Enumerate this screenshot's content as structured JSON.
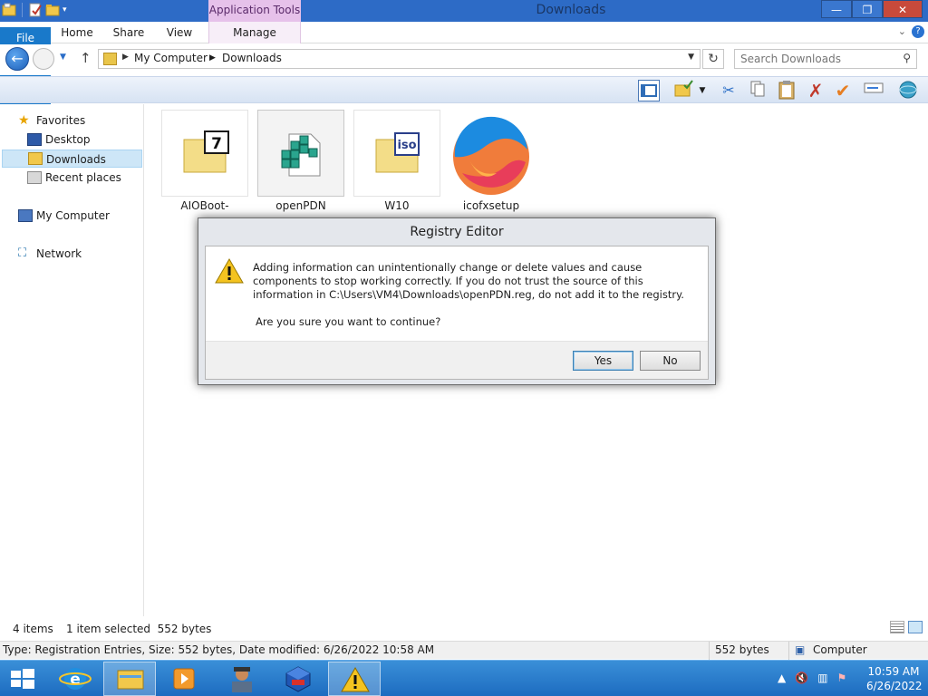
{
  "window": {
    "title": "Downloads",
    "context_tab": "Application Tools",
    "buttons": {
      "minimize": "—",
      "maximize": "❐",
      "close": "✕"
    }
  },
  "ribbon": {
    "tabs": [
      {
        "label": "File"
      },
      {
        "label": "Home"
      },
      {
        "label": "Share"
      },
      {
        "label": "View"
      },
      {
        "label": "Manage"
      }
    ]
  },
  "address": {
    "crumbs": [
      "My Computer",
      "Downloads"
    ],
    "search_placeholder": "Search Downloads"
  },
  "sidebar": {
    "items": [
      {
        "label": "Favorites",
        "icon": "star-icon"
      },
      {
        "label": "Desktop",
        "icon": "desktop-icon"
      },
      {
        "label": "Downloads",
        "icon": "downloads-folder-icon",
        "selected": true
      },
      {
        "label": "Recent places",
        "icon": "recent-places-icon"
      },
      {
        "label": "My Computer",
        "icon": "computer-icon"
      },
      {
        "label": "Network",
        "icon": "network-icon"
      }
    ]
  },
  "files": [
    {
      "name": "AIOBoot-v0.9.9.1\n0",
      "icon": "7zip-archive-icon"
    },
    {
      "name": "openPDN",
      "icon": "registry-file-icon",
      "selected": true
    },
    {
      "name": "W10",
      "icon": "iso-file-icon"
    },
    {
      "name": "icofxsetup",
      "icon": "icofx-installer-icon"
    }
  ],
  "dialog": {
    "title": "Registry Editor",
    "message": "Adding information can unintentionally change or delete values and cause components to stop working correctly. If you do not trust the source of this information in C:\\Users\\VM4\\Downloads\\openPDN.reg, do not add it to the registry.",
    "question": "Are you sure you want to continue?",
    "yes": "Yes",
    "no": "No"
  },
  "status": {
    "count": "4 items",
    "selection": "1 item selected  552 bytes"
  },
  "details": {
    "info": "Type: Registration Entries, Size: 552 bytes, Date modified: 6/26/2022 10:58 AM",
    "size": "552 bytes",
    "location": "Computer"
  },
  "taskbar": {
    "time": "10:59 AM",
    "date": "6/26/2022",
    "tray_icons": [
      "show-hidden-icons-arrow",
      "volume-muted-icon",
      "network-icon",
      "action-center-icon"
    ]
  },
  "colors": {
    "titlebar": "#2d6bc6",
    "file_tab": "#1979ca",
    "taskbar": "#1d6cc0",
    "selection": "#cde6f7"
  }
}
